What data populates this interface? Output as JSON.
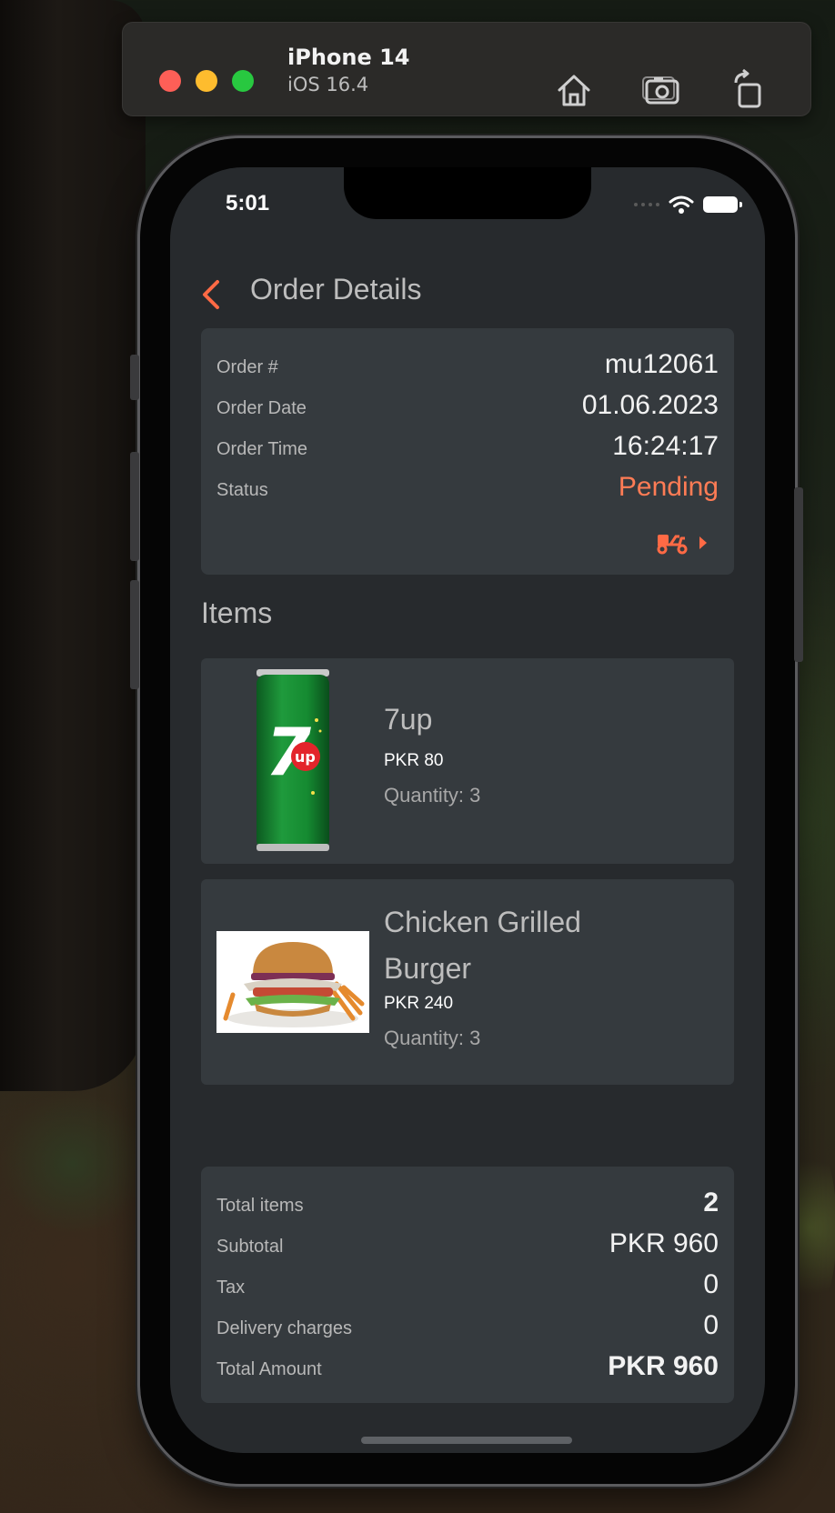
{
  "simulator": {
    "device_name": "iPhone 14",
    "os_version": "iOS 16.4",
    "buttons": [
      "home-icon",
      "screenshot-icon",
      "rotate-icon"
    ]
  },
  "status_bar": {
    "time": "5:01"
  },
  "header": {
    "title": "Order Details"
  },
  "order": {
    "number_label": "Order #",
    "number": "mu12061",
    "date_label": "Order Date",
    "date": "01.06.2023",
    "time_label": "Order Time",
    "time": "16:24:17",
    "status_label": "Status",
    "status": "Pending",
    "status_color": "#ff7c55"
  },
  "items_heading": "Items",
  "items": [
    {
      "name": "7up",
      "price": "PKR 80",
      "quantity": "Quantity: 3",
      "image": "7up-can-image"
    },
    {
      "name": "Chicken Grilled Burger",
      "name_line1": "Chicken Grilled",
      "name_line2": "Burger",
      "price": "PKR 240",
      "quantity": "Quantity: 3",
      "image": "burger-image"
    }
  ],
  "summary": {
    "total_items_label": "Total items",
    "total_items": "2",
    "subtotal_label": "Subtotal",
    "subtotal": "PKR 960",
    "tax_label": "Tax",
    "tax": "0",
    "delivery_label": "Delivery charges",
    "delivery": "0",
    "total_label": "Total Amount",
    "total": "PKR 960"
  },
  "colors": {
    "accent": "#ff7c55",
    "card_bg": "#353a3e",
    "screen_bg": "#272a2d"
  }
}
